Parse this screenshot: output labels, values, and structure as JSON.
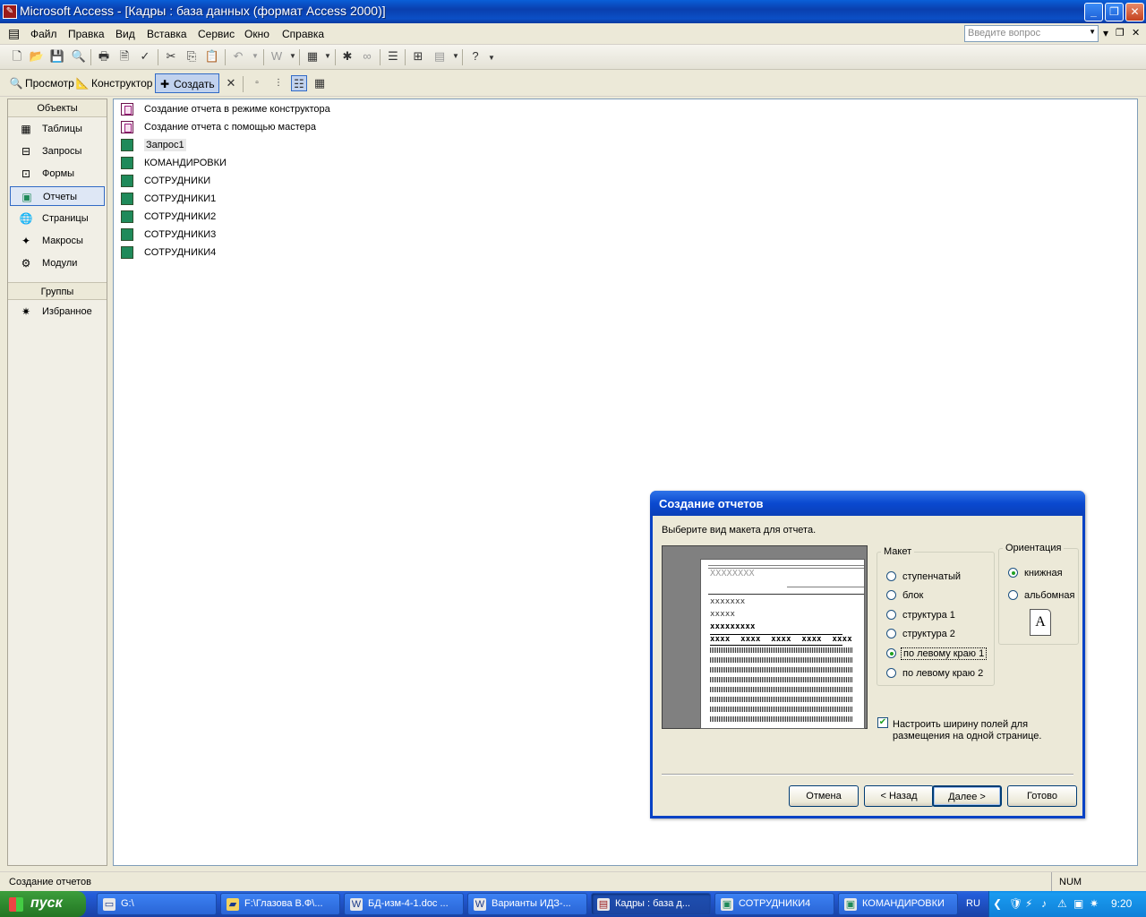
{
  "window": {
    "title": "Microsoft Access - [Кадры : база данных (формат Access 2000)]"
  },
  "menu": [
    "Файл",
    "Правка",
    "Вид",
    "Вставка",
    "Сервис",
    "Окно",
    "Справка"
  ],
  "ask_placeholder": "Введите вопрос",
  "db_toolbar": {
    "preview": "Просмотр",
    "design": "Конструктор",
    "create": "Создать"
  },
  "objects": {
    "header": "Объекты",
    "items": [
      "Таблицы",
      "Запросы",
      "Формы",
      "Отчеты",
      "Страницы",
      "Макросы",
      "Модули"
    ],
    "groups_header": "Группы",
    "groups": [
      "Избранное"
    ]
  },
  "reports_list": [
    "Создание отчета в режиме конструктора",
    "Создание отчета с помощью мастера",
    "Запрос1",
    "КОМАНДИРОВКИ",
    "СОТРУДНИКИ",
    "СОТРУДНИКИ1",
    "СОТРУДНИКИ2",
    "СОТРУДНИКИ3",
    "СОТРУДНИКИ4"
  ],
  "dialog": {
    "title": "Создание отчетов",
    "prompt": "Выберите вид макета для отчета.",
    "preview": {
      "title_text": "XXXXXXXX",
      "line1": "xxxxxxx",
      "line2": "xxxxx",
      "line3": "xxxxxxxxx",
      "header_cells": [
        "xxxx",
        "xxxx",
        "xxxx",
        "xxxx",
        "xxxx"
      ]
    },
    "layout_legend": "Макет",
    "layout_options": [
      "ступенчатый",
      "блок",
      "структура 1",
      "структура 2",
      "по левому краю 1",
      "по левому краю 2"
    ],
    "layout_selected": "по левому краю 1",
    "orientation_legend": "Ориентация",
    "orientation_options": [
      "книжная",
      "альбомная"
    ],
    "orientation_selected": "книжная",
    "orientation_icon_letter": "A",
    "fit_checkbox_line1": "Настроить ширину полей для",
    "fit_checkbox_line2": "размещения на одной странице.",
    "buttons": {
      "cancel": "Отмена",
      "back": "< Назад",
      "next": "Далее >",
      "finish": "Готово"
    }
  },
  "status": {
    "text": "Создание отчетов",
    "num": "NUM"
  },
  "taskbar": {
    "start": "пуск",
    "tasks": [
      "G:\\",
      "F:\\Глазова В.Ф\\...",
      "БД-изм-4-1.doc ...",
      "Варианты ИДЗ-...",
      "Кадры : база д...",
      "СОТРУДНИКИ4",
      "КОМАНДИРОВКИ"
    ],
    "lang": "RU",
    "clock": "9:20"
  }
}
